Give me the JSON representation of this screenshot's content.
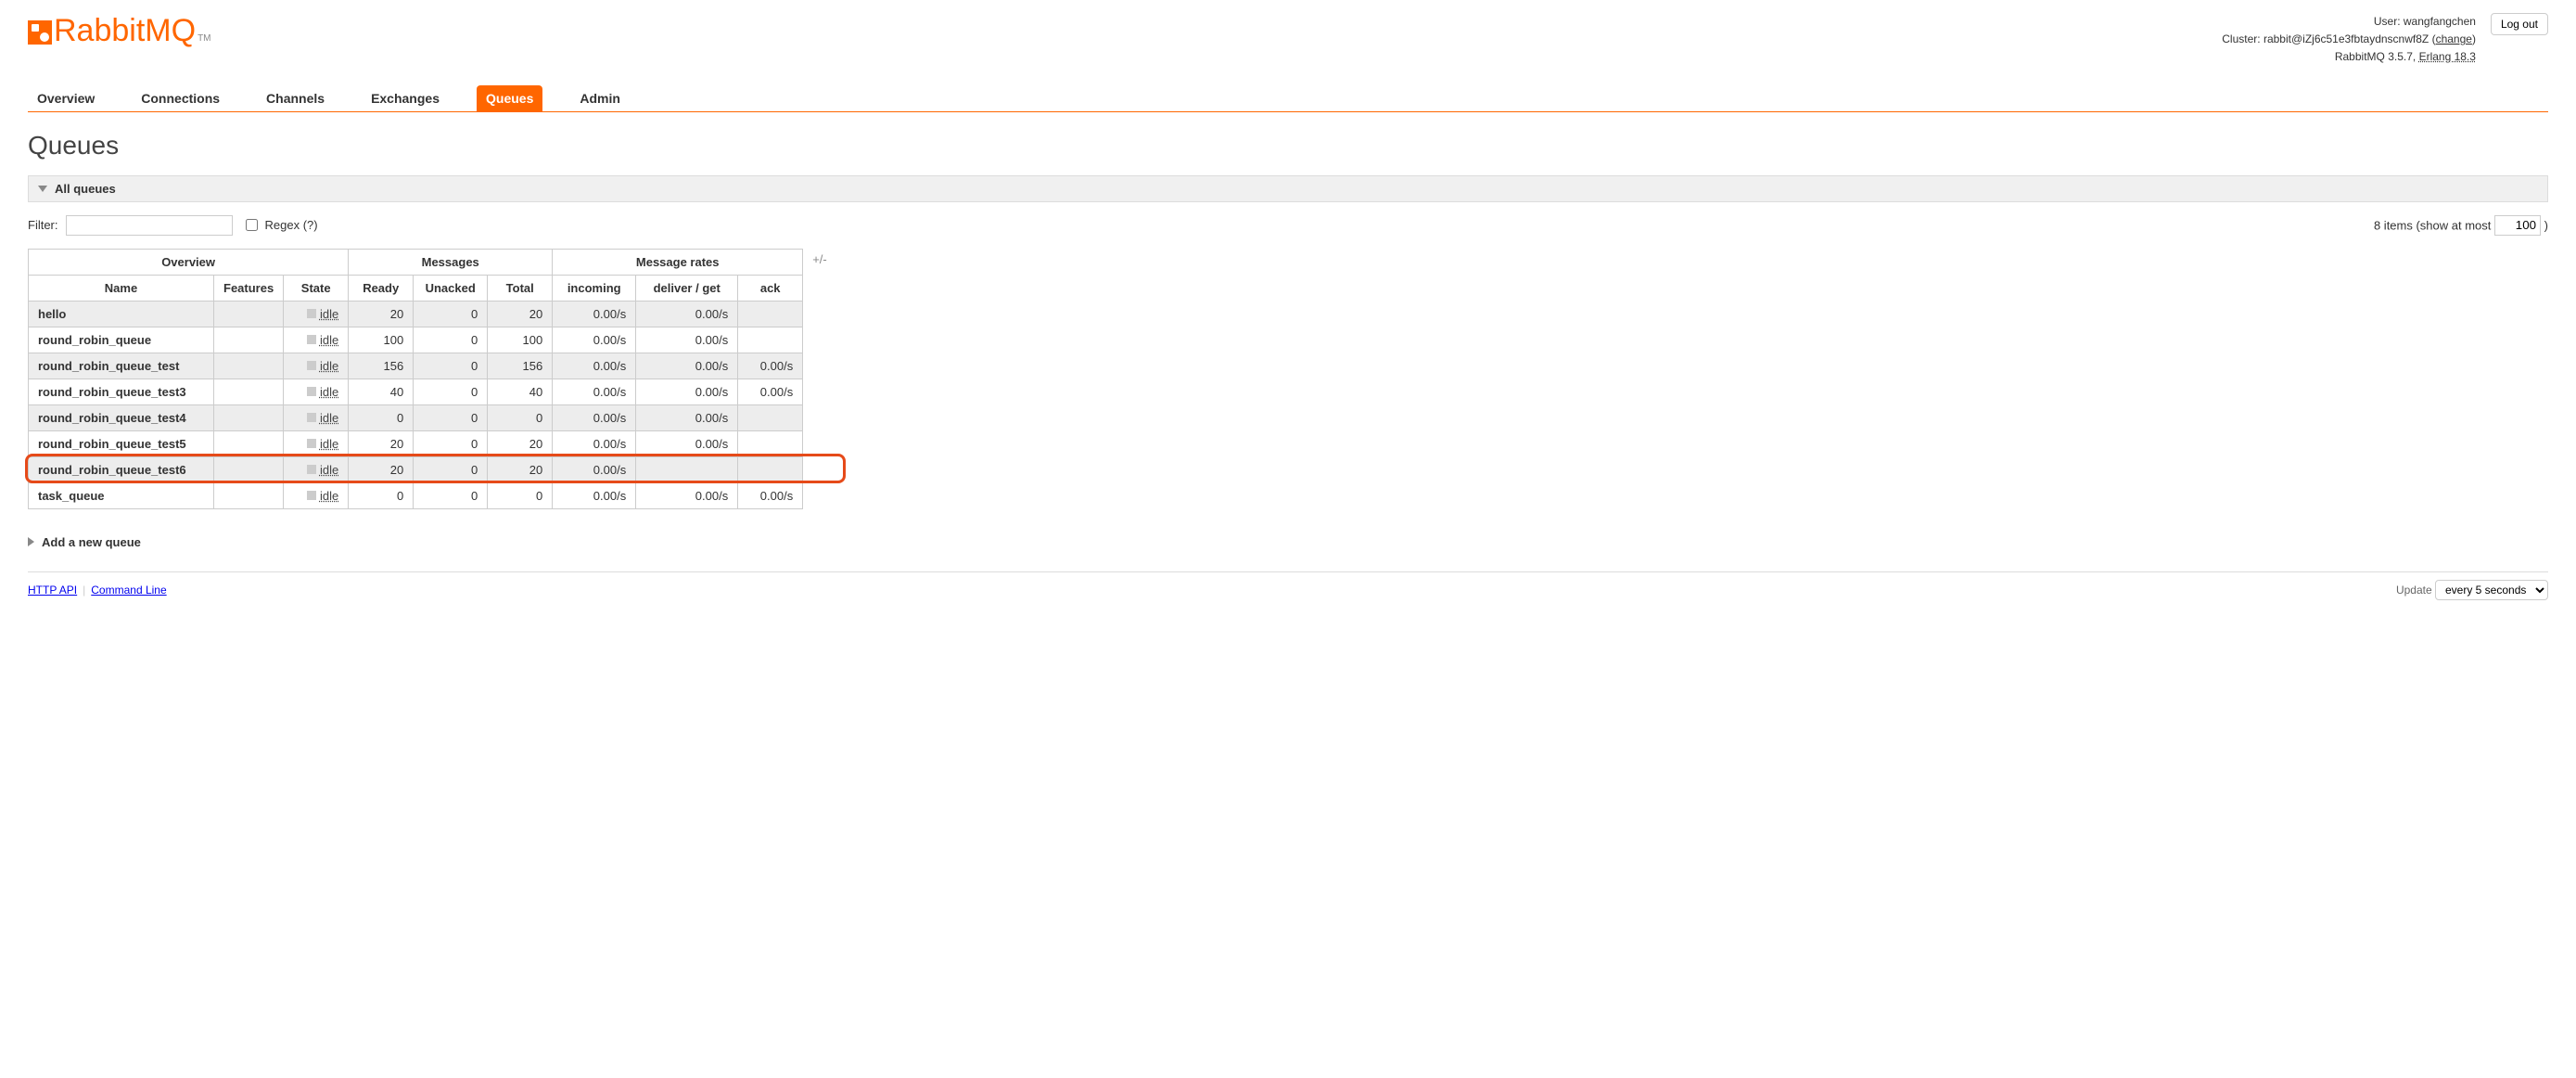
{
  "brand": {
    "name": "RabbitMQ",
    "tm": "TM"
  },
  "header": {
    "user_label": "User:",
    "user_name": "wangfangchen",
    "cluster_label": "Cluster:",
    "cluster_name": "rabbit@iZj6c51e3fbtaydnscnwf8Z",
    "change_text": "change",
    "version_product": "RabbitMQ 3.5.7,",
    "erlang_label": "Erlang 18.3",
    "logout": "Log out"
  },
  "tabs": [
    {
      "label": "Overview",
      "active": false
    },
    {
      "label": "Connections",
      "active": false
    },
    {
      "label": "Channels",
      "active": false
    },
    {
      "label": "Exchanges",
      "active": false
    },
    {
      "label": "Queues",
      "active": true
    },
    {
      "label": "Admin",
      "active": false
    }
  ],
  "page_title": "Queues",
  "section_all_queues": "All queues",
  "filter": {
    "label": "Filter:",
    "value": "",
    "regex_label": "Regex (?)"
  },
  "items_summary": {
    "count_text": "8 items (show at most",
    "value": "100",
    "close_paren": ")"
  },
  "table": {
    "group_headers": [
      "Overview",
      "Messages",
      "Message rates"
    ],
    "sub_headers": [
      "Name",
      "Features",
      "State",
      "Ready",
      "Unacked",
      "Total",
      "incoming",
      "deliver / get",
      "ack"
    ],
    "rows": [
      {
        "name": "hello",
        "state": "idle",
        "ready": "20",
        "unacked": "0",
        "total": "20",
        "incoming": "0.00/s",
        "deliver": "0.00/s",
        "ack": "",
        "zebra": true
      },
      {
        "name": "round_robin_queue",
        "state": "idle",
        "ready": "100",
        "unacked": "0",
        "total": "100",
        "incoming": "0.00/s",
        "deliver": "0.00/s",
        "ack": "",
        "zebra": false
      },
      {
        "name": "round_robin_queue_test",
        "state": "idle",
        "ready": "156",
        "unacked": "0",
        "total": "156",
        "incoming": "0.00/s",
        "deliver": "0.00/s",
        "ack": "0.00/s",
        "zebra": true
      },
      {
        "name": "round_robin_queue_test3",
        "state": "idle",
        "ready": "40",
        "unacked": "0",
        "total": "40",
        "incoming": "0.00/s",
        "deliver": "0.00/s",
        "ack": "0.00/s",
        "zebra": false
      },
      {
        "name": "round_robin_queue_test4",
        "state": "idle",
        "ready": "0",
        "unacked": "0",
        "total": "0",
        "incoming": "0.00/s",
        "deliver": "0.00/s",
        "ack": "",
        "zebra": true
      },
      {
        "name": "round_robin_queue_test5",
        "state": "idle",
        "ready": "20",
        "unacked": "0",
        "total": "20",
        "incoming": "0.00/s",
        "deliver": "0.00/s",
        "ack": "",
        "zebra": false
      },
      {
        "name": "round_robin_queue_test6",
        "state": "idle",
        "ready": "20",
        "unacked": "0",
        "total": "20",
        "incoming": "0.00/s",
        "deliver": "",
        "ack": "",
        "zebra": true,
        "highlighted": true
      },
      {
        "name": "task_queue",
        "state": "idle",
        "ready": "0",
        "unacked": "0",
        "total": "0",
        "incoming": "0.00/s",
        "deliver": "0.00/s",
        "ack": "0.00/s",
        "zebra": false
      }
    ]
  },
  "plus_minus": "+/-",
  "add_queue_label": "Add a new queue",
  "footer": {
    "http_api": "HTTP API",
    "cmdline": "Command Line",
    "update_label": "Update",
    "update_value": "every 5 seconds"
  }
}
